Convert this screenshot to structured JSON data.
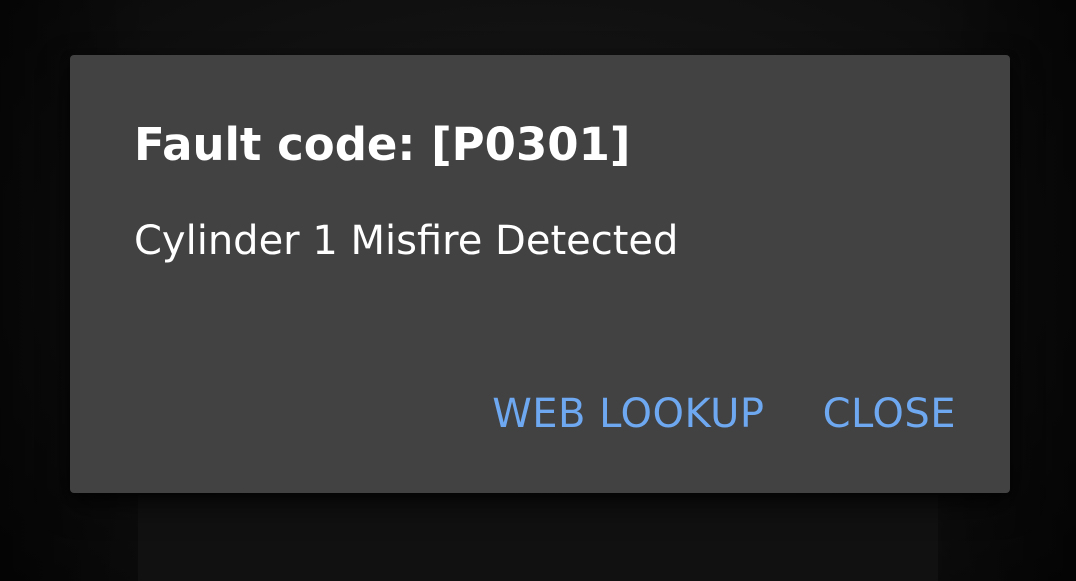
{
  "dialog": {
    "title": "Fault code: [P0301]",
    "message": "Cylinder 1 Misfire Detected",
    "buttons": {
      "web_lookup": "WEB LOOKUP",
      "close": "CLOSE"
    }
  },
  "colors": {
    "dialog_background": "#424242",
    "text": "#ffffff",
    "accent": "#6ea8f0",
    "backdrop": "#111111"
  }
}
